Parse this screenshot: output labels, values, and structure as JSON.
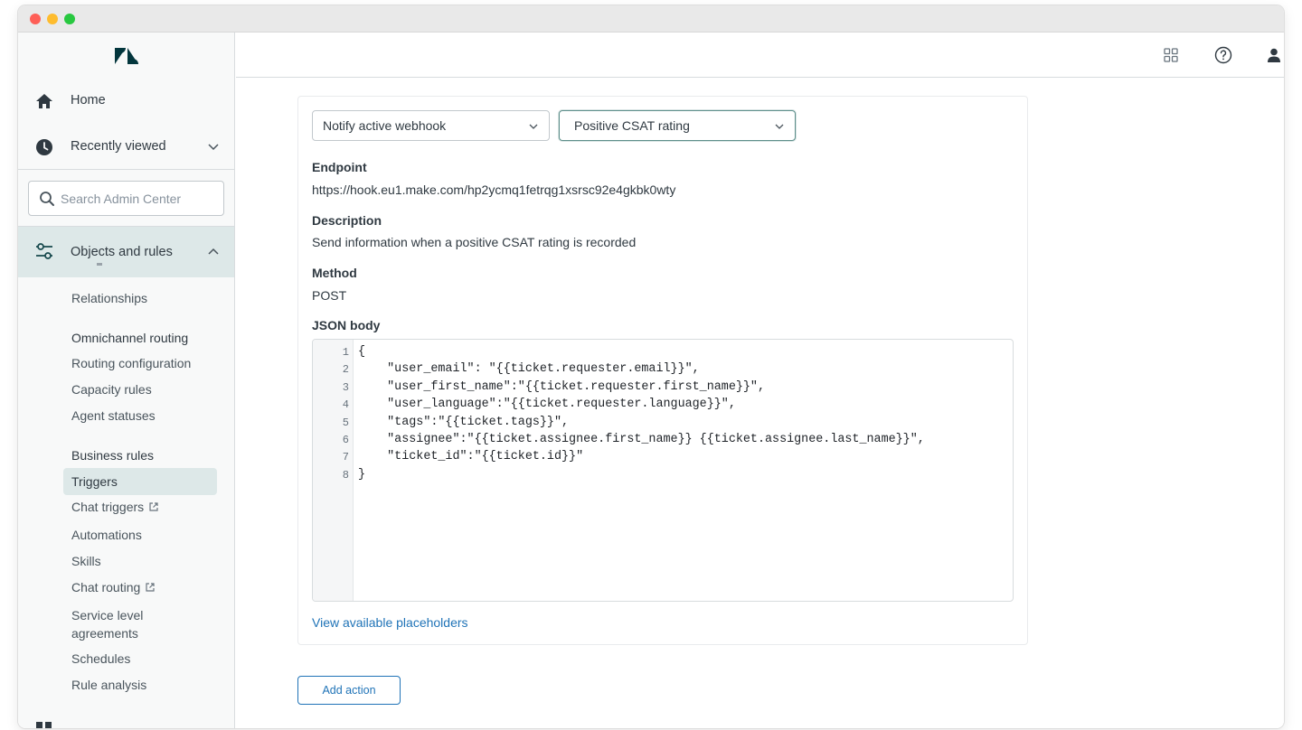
{
  "sidebar": {
    "nav": {
      "home": "Home",
      "recently_viewed": "Recently viewed",
      "objects_and_rules": "Objects and rules"
    },
    "search": {
      "placeholder": "Search Admin Center",
      "value": ""
    },
    "items": {
      "relationships": "Relationships",
      "omnichannel_heading": "Omnichannel routing",
      "routing_configuration": "Routing configuration",
      "capacity_rules": "Capacity rules",
      "agent_statuses": "Agent statuses",
      "business_rules_heading": "Business rules",
      "triggers": "Triggers",
      "chat_triggers": "Chat triggers",
      "automations": "Automations",
      "skills": "Skills",
      "chat_routing": "Chat routing",
      "sla_line1": "Service level",
      "sla_line2": "agreements",
      "schedules": "Schedules",
      "rule_analysis": "Rule analysis"
    }
  },
  "action": {
    "action_select": "Notify active webhook",
    "webhook_select": "Positive CSAT rating",
    "endpoint_label": "Endpoint",
    "endpoint_value": "https://hook.eu1.make.com/hp2ycmq1fetrqg1xsrsc92e4gkbk0wty",
    "description_label": "Description",
    "description_value": "Send information when a positive CSAT rating is recorded",
    "method_label": "Method",
    "method_value": "POST",
    "json_label": "JSON body",
    "code_lines": [
      "{",
      "    \"user_email\": \"{{ticket.requester.email}}\",",
      "    \"user_first_name\":\"{{ticket.requester.first_name}}\",",
      "    \"user_language\":\"{{ticket.requester.language}}\",",
      "    \"tags\":\"{{ticket.tags}}\",",
      "    \"assignee\":\"{{ticket.assignee.first_name}} {{ticket.assignee.last_name}}\",",
      "    \"ticket_id\":\"{{ticket.id}}\"",
      "}"
    ],
    "line_numbers": [
      "1",
      "2",
      "3",
      "4",
      "5",
      "6",
      "7",
      "8"
    ],
    "placeholders_link": "View available placeholders"
  },
  "add_action_label": "Add action",
  "colors": {
    "accent_link": "#1f73b7",
    "sidebar_bg": "#f8f9f9",
    "active_bg": "#dde8e8",
    "focus_border": "#5e8f8b",
    "icon_dark": "#2f3941"
  },
  "icons": {
    "logo": "zendesk-logo",
    "home": "home-icon",
    "recent": "clock-icon",
    "objects": "sliders-icon",
    "search": "search-icon",
    "external": "external-link-icon",
    "apps": "grid-icon",
    "help": "help-circle-icon",
    "profile": "user-icon"
  }
}
